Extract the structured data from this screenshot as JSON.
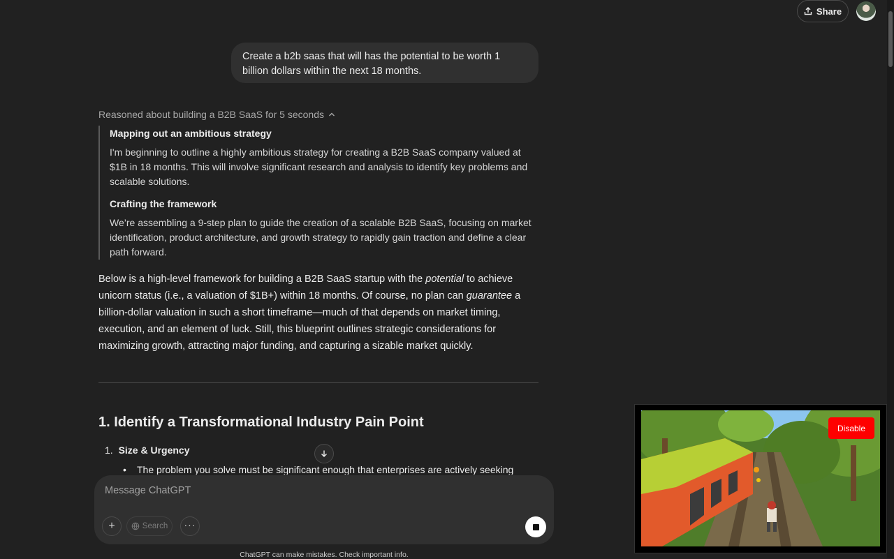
{
  "header": {
    "share_label": "Share"
  },
  "conversation": {
    "user_message": "Create a b2b saas that will has the potential to be worth 1 billion dollars within the next 18 months.",
    "reasoning": {
      "summary": "Reasoned about building a B2B SaaS for 5 seconds",
      "steps": [
        {
          "title": "Mapping out an ambitious strategy",
          "body": "I'm beginning to outline a highly ambitious strategy for creating a B2B SaaS company valued at $1B in 18 months. This will involve significant research and analysis to identify key problems and scalable solutions."
        },
        {
          "title": "Crafting the framework",
          "body": "We’re assembling a 9-step plan to guide the creation of a scalable B2B SaaS, focusing on market identification, product architecture, and growth strategy to rapidly gain traction and define a clear path forward."
        }
      ]
    },
    "answer": {
      "intro_parts": [
        "Below is a high-level framework for building a B2B SaaS startup with the ",
        "potential",
        " to achieve unicorn status (i.e., a valuation of $1B+) within 18 months. Of course, no plan can ",
        "guarantee",
        " a billion-dollar valuation in such a short timeframe—much of that depends on market timing, execution, and an element of luck. Still, this blueprint outlines strategic considerations for maximizing growth, attracting major funding, and capturing a sizable market quickly."
      ],
      "section_heading": "1. Identify a Transformational Industry Pain Point",
      "list_number": "1.",
      "list_item_title": "Size & Urgency",
      "bullet_text": "The problem you solve must be significant enough that enterprises are actively seeking"
    }
  },
  "composer": {
    "placeholder": "Message ChatGPT",
    "search_label": "Search"
  },
  "footer": {
    "disclaimer": "ChatGPT can make mistakes. Check important info."
  },
  "video_overlay": {
    "disable_label": "Disable"
  },
  "colors": {
    "background": "#212121",
    "bubble": "#303030",
    "accent_red": "#ff0000"
  }
}
